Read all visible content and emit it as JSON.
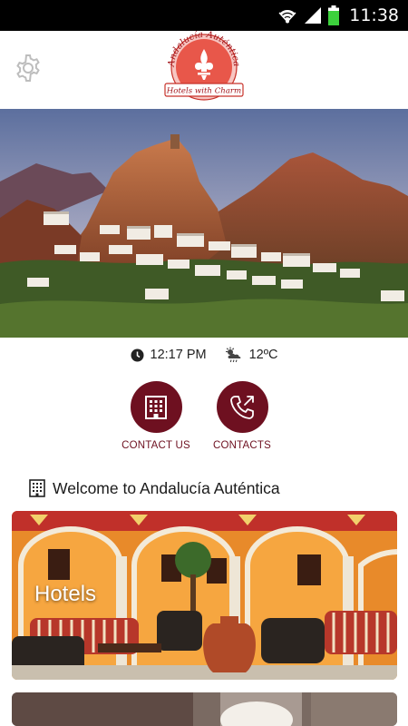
{
  "status_bar": {
    "time": "11:38",
    "icons": [
      "wifi-icon",
      "signal-icon",
      "battery-icon"
    ],
    "battery_color": "#3dd13d"
  },
  "header": {
    "settings_icon": "gear-icon",
    "logo": {
      "top_text": "Andalucía Auténtica",
      "ribbon_text": "Hotels with Charm"
    }
  },
  "info": {
    "time": "12:17 PM",
    "time_icon": "clock-icon",
    "temperature": "12ºC",
    "weather_icon": "partly-cloudy-rain-icon"
  },
  "actions": {
    "contact_us": {
      "label": "CONTACT US",
      "icon": "building-icon"
    },
    "contacts": {
      "label": "CONTACTS",
      "icon": "phone-outgoing-icon"
    }
  },
  "welcome": {
    "icon": "building-icon",
    "text": "Welcome to Andalucía Auténtica"
  },
  "cards": [
    {
      "title": "Hotels"
    }
  ],
  "colors": {
    "accent": "#6e1020",
    "logo_red": "#c8322a"
  }
}
